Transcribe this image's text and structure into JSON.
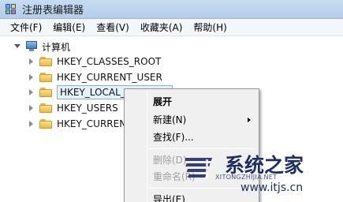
{
  "window": {
    "title": "注册表编辑器"
  },
  "menubar": [
    "文件(F)",
    "编辑(E)",
    "查看(V)",
    "收藏夹(A)",
    "帮助(H)"
  ],
  "tree": {
    "root": "计算机",
    "keys": [
      "HKEY_CLASSES_ROOT",
      "HKEY_CURRENT_USER",
      "HKEY_LOCAL_MACHINE",
      "HKEY_USERS",
      "HKEY_CURRENT_CONFIG"
    ],
    "selected_index": 2
  },
  "context_menu": {
    "items": [
      {
        "label": "展开"
      },
      {
        "label": "新建(N)"
      },
      {
        "label": "查找(F)..."
      },
      {
        "label": "删除(D)"
      },
      {
        "label": "重命名(R)"
      },
      {
        "label": "导出(E)"
      }
    ]
  },
  "watermark": {
    "main": "系统之家",
    "sub": "XITONGZHIJIA.NET",
    "url": "www.itjs.cn"
  },
  "colors": {
    "selection_fill": "#e5f1fb",
    "selection_border": "#7fb4e2",
    "watermark_blue": "#1f2f66"
  }
}
